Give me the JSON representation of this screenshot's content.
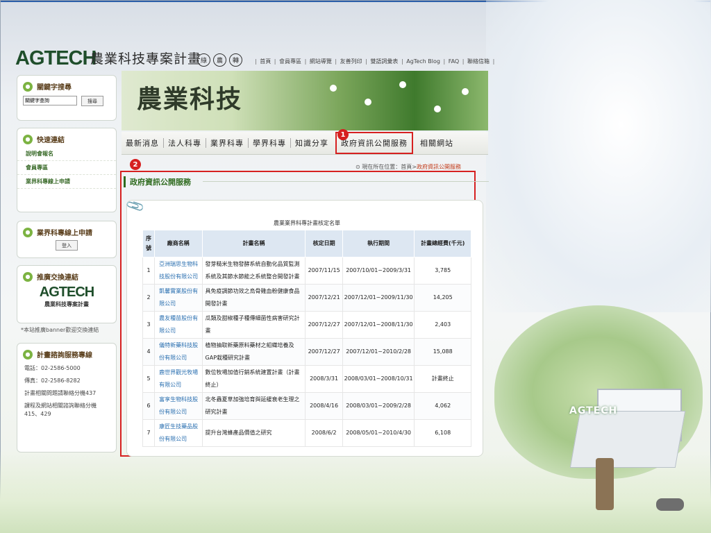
{
  "header": {
    "logo": "AGTECH",
    "program_name": "農業科技專案計畫",
    "badges": [
      "綠",
      "農",
      "轉"
    ],
    "top_links": [
      "首頁",
      "會員專區",
      "網站導覽",
      "友善列印",
      "雙語詞彙表",
      "AgTech Blog",
      "FAQ",
      "聯絡信箱"
    ]
  },
  "banner": {
    "title": "農業科技"
  },
  "nav": {
    "items": [
      "最新消息",
      "法人科專",
      "業界科專",
      "學界科專",
      "知識分享",
      "政府資訊公開服務",
      "相關網站"
    ],
    "active_index": 5,
    "markers": [
      "1",
      "2"
    ]
  },
  "breadcrumb": {
    "prefix": "現在所在位置：首頁>",
    "current": "政府資訊公開服務"
  },
  "sidebar": {
    "keyword_search": {
      "title": "關鍵字搜尋",
      "placeholder": "關鍵字查詢",
      "button": "搜尋"
    },
    "quick_links": {
      "title": "快速連結",
      "items": [
        "說明會報名",
        "會員專區",
        "業界科專線上申請"
      ]
    },
    "online_apply": {
      "title": "業界科專線上申請",
      "button": "登入"
    },
    "banner_exchange": {
      "title": "推廣交換連結",
      "logo": "AGTECH",
      "subtitle": "農業科技專案計畫"
    },
    "note": "*本站推廣banner歡迎交換連結",
    "consult": {
      "title": "計畫諮詢服務專線",
      "lines": [
        "電話：02-2586-5000",
        "傳真：02-2586-8282",
        "計畫相關問題請聯絡分機437",
        "課程及網站相關諮詢聯絡分機415、429"
      ]
    }
  },
  "content": {
    "section_title": "政府資訊公開服務",
    "table_caption": "農業業界科專計畫核定名單",
    "columns": [
      "序號",
      "廠商名稱",
      "計畫名稱",
      "核定日期",
      "執行期間",
      "計畫總經費(千元)"
    ],
    "rows": [
      [
        "1",
        "亞洲瑞思生物科技股份有限公司",
        "發芽糙米生物發酵系統自動化品質監測系統及其節水節能之系統整合開發計畫",
        "2007/11/15",
        "2007/10/01~2009/3/31",
        "3,785"
      ],
      [
        "2",
        "凱馨實業股份有限公司",
        "具免疫調節功效之烏骨雞血粉健康食品開發計畫",
        "2007/12/21",
        "2007/12/01~2009/11/30",
        "14,205"
      ],
      [
        "3",
        "農友種苗股份有限公司",
        "瓜類及甜椒種子種傳細菌性病害研究計畫",
        "2007/12/27",
        "2007/12/01~2008/11/30",
        "2,403"
      ],
      [
        "4",
        "儀特新藥科技股份有限公司",
        "植物抽取新藥原料藥材之組織培養及GAP栽種研究計畫",
        "2007/12/27",
        "2007/12/01~2010/2/28",
        "15,088"
      ],
      [
        "5",
        "鹿世界觀光牧場有限公司",
        "數位牧場加值行銷系統建置計畫（計畫終止）",
        "2008/3/31",
        "2008/03/01~2008/10/31",
        "計畫終止"
      ],
      [
        "6",
        "富享生物科技股份有限公司",
        "北冬蟲夏草加強培育與延緩衰老生理之研究計畫",
        "2008/4/16",
        "2008/03/01~2009/2/28",
        "4,062"
      ],
      [
        "7",
        "康匠生技藥品股份有限公司",
        "提升台灣蜂產品價值之研究",
        "2008/6/2",
        "2008/05/01~2010/4/30",
        "6,108"
      ]
    ]
  },
  "decor": {
    "watermark": "AGTECH"
  },
  "colors": {
    "accent_red": "#d62020",
    "brand_green": "#2f6b1f",
    "link_blue": "#2a6fb0"
  }
}
